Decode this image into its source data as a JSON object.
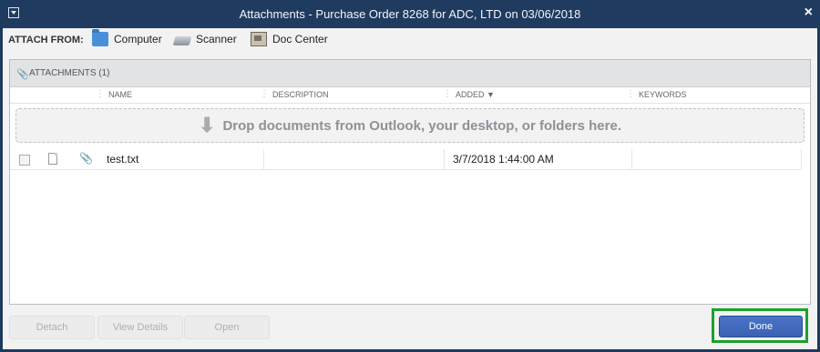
{
  "window": {
    "title": "Attachments - Purchase Order 8268 for ADC, LTD on 03/06/2018",
    "close": "×"
  },
  "attach_bar": {
    "label": "ATTACH FROM:",
    "sources": [
      {
        "label": "Computer",
        "icon": "folder-icon"
      },
      {
        "label": "Scanner",
        "icon": "scanner-icon"
      },
      {
        "label": "Doc Center",
        "icon": "doc-center-icon"
      }
    ]
  },
  "attachments": {
    "title": "ATTACHMENTS (1)",
    "columns": {
      "name": "NAME",
      "description": "DESCRIPTION",
      "added": "ADDED ▼",
      "keywords": "KEYWORDS"
    },
    "dropzone_text": "Drop documents from Outlook, your desktop, or folders here.",
    "rows": [
      {
        "name": "test.txt",
        "description": "",
        "added": "3/7/2018 1:44:00 AM",
        "keywords": ""
      }
    ]
  },
  "footer": {
    "detach": "Detach",
    "view_details": "View Details",
    "open": "Open",
    "done": "Done"
  },
  "colors": {
    "titlebar": "#1f3b60",
    "done_button": "#3a60b2",
    "highlight": "#1aa12d"
  }
}
